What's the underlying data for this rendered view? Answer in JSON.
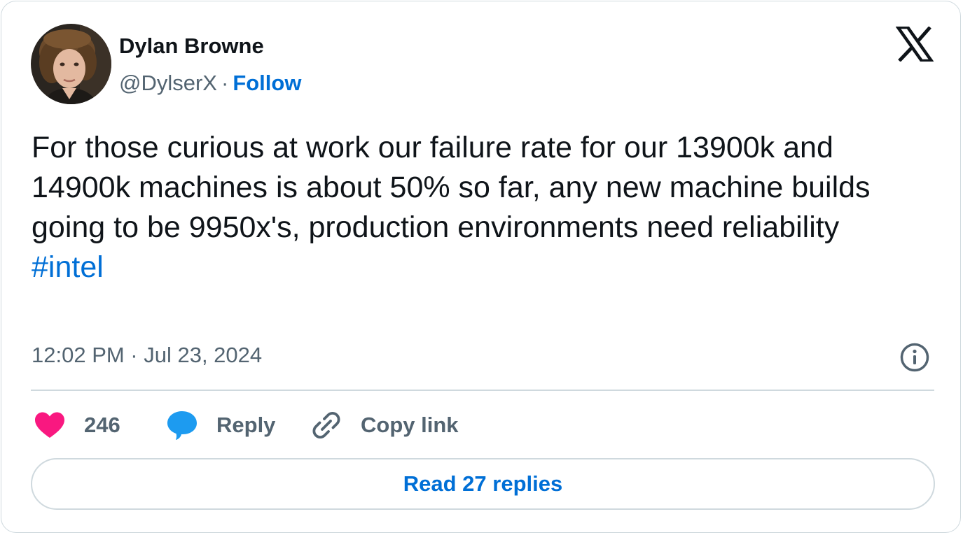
{
  "author": {
    "name": "Dylan Browne",
    "handle": "@DylserX",
    "separator": "·",
    "follow_label": "Follow",
    "avatar_icon": "profile-photo"
  },
  "brand": {
    "logo": "x-logo",
    "link_color": "#006fd6",
    "like_color": "#f91880",
    "reply_color": "#1d9bf0",
    "text_color": "#0f1419",
    "muted_color": "#536471"
  },
  "tweet": {
    "text": "For those curious at work our failure rate for our 13900k and 14900k machines is about 50% so far, any new machine builds going to be 9950x's, production environments need reliability",
    "hashtag": "#intel",
    "timestamp": "12:02 PM · Jul 23, 2024"
  },
  "actions": {
    "like_count": "246",
    "reply_label": "Reply",
    "copy_link_label": "Copy link",
    "like_icon": "heart-icon",
    "reply_icon": "speech-bubble-icon",
    "copy_icon": "link-icon",
    "info_icon": "info-icon"
  },
  "footer": {
    "read_replies_label": "Read 27 replies"
  }
}
